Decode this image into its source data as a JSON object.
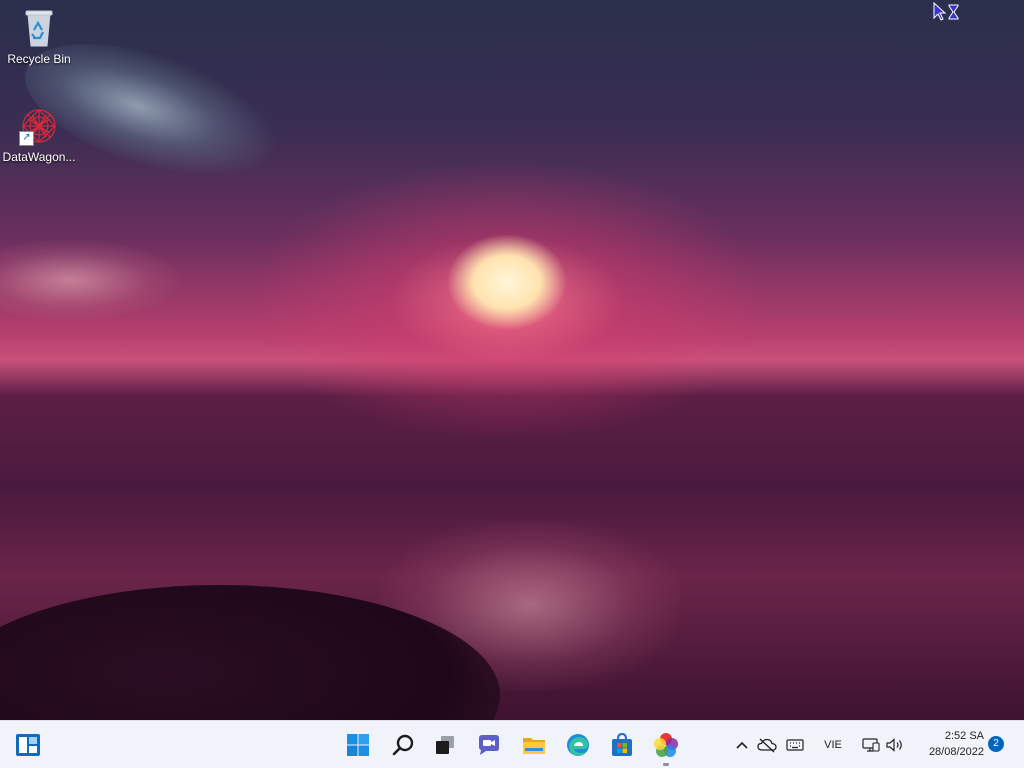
{
  "desktop": {
    "icons": [
      {
        "label": "Recycle Bin",
        "icon": "recycle-bin-icon"
      },
      {
        "label": "DataWagon...",
        "icon": "datawagon-app-icon"
      }
    ]
  },
  "taskbar": {
    "items": [
      {
        "name": "widgets",
        "icon": "widgets-icon"
      },
      {
        "name": "start",
        "icon": "windows-start-icon"
      },
      {
        "name": "search",
        "icon": "search-icon"
      },
      {
        "name": "task-view",
        "icon": "task-view-icon"
      },
      {
        "name": "chat",
        "icon": "chat-icon"
      },
      {
        "name": "file-explorer",
        "icon": "folder-icon"
      },
      {
        "name": "edge",
        "icon": "edge-browser-icon"
      },
      {
        "name": "store",
        "icon": "store-icon"
      },
      {
        "name": "photos",
        "icon": "photos-app-icon"
      }
    ],
    "tray": {
      "language": "VIE",
      "clock_time": "2:52 SA",
      "clock_date": "28/08/2022",
      "notification_count": "2"
    }
  },
  "colors": {
    "taskbar_bg": "#f0f3f9",
    "accent": "#0067c0",
    "windows_blue": "#1a8fe3"
  }
}
